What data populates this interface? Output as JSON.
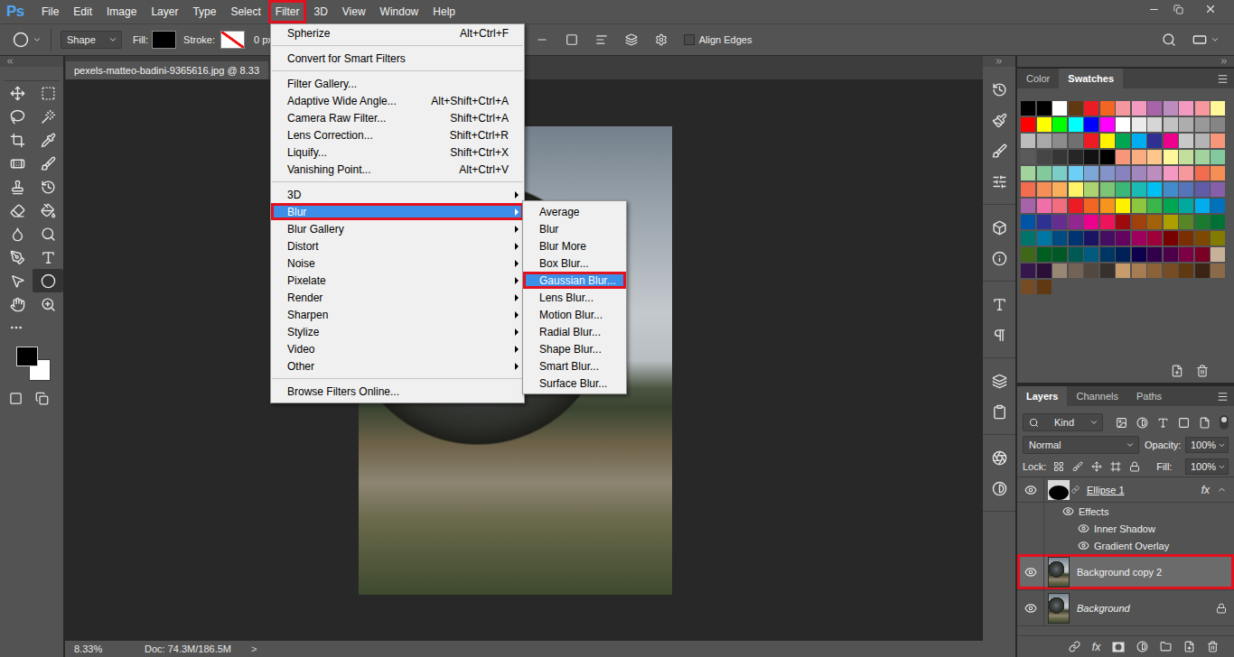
{
  "menu_bar": {
    "logo": "Ps",
    "items": [
      {
        "label": "File",
        "selected": false,
        "annotated": false
      },
      {
        "label": "Edit",
        "selected": false,
        "annotated": false
      },
      {
        "label": "Image",
        "selected": false,
        "annotated": false
      },
      {
        "label": "Layer",
        "selected": false,
        "annotated": false
      },
      {
        "label": "Type",
        "selected": false,
        "annotated": false
      },
      {
        "label": "Select",
        "selected": false,
        "annotated": false
      },
      {
        "label": "Filter",
        "selected": true,
        "annotated": true
      },
      {
        "label": "3D",
        "selected": false,
        "annotated": false
      },
      {
        "label": "View",
        "selected": false,
        "annotated": false
      },
      {
        "label": "Window",
        "selected": false,
        "annotated": false
      },
      {
        "label": "Help",
        "selected": false,
        "annotated": false
      }
    ]
  },
  "options_bar": {
    "mode": "Shape",
    "fill_label": "Fill:",
    "stroke_label": "Stroke:",
    "stroke_width": "0 px",
    "align_edges": {
      "label": "Align Edges",
      "checked": false
    }
  },
  "toolbar": {
    "tools": [
      {
        "selected": false
      },
      {
        "selected": false
      },
      {
        "selected": false
      },
      {
        "selected": false
      },
      {
        "selected": false
      },
      {
        "selected": false
      },
      {
        "selected": false
      },
      {
        "selected": false
      },
      {
        "selected": false
      },
      {
        "selected": false
      },
      {
        "selected": false
      },
      {
        "selected": false
      },
      {
        "selected": false
      },
      {
        "selected": false
      },
      {
        "selected": false
      },
      {
        "selected": false
      },
      {
        "selected": false
      },
      {
        "selected": true
      },
      {
        "selected": false
      },
      {
        "selected": false
      }
    ]
  },
  "document": {
    "tab": "pexels-matteo-badini-9365616.jpg @ 8.33"
  },
  "status_bar": {
    "zoom": "8.33%",
    "doc": "Doc: 74.3M/186.5M",
    "arrow": ">"
  },
  "filter_menu": {
    "items": [
      {
        "kind": "item",
        "label": "Spherize",
        "shortcut": "Alt+Ctrl+F",
        "submenu": false,
        "selected": false,
        "annotated": false
      },
      {
        "kind": "separator"
      },
      {
        "kind": "item",
        "label": "Convert for Smart Filters",
        "submenu": false,
        "selected": false,
        "annotated": false
      },
      {
        "kind": "separator"
      },
      {
        "kind": "item",
        "label": "Filter Gallery...",
        "submenu": false,
        "selected": false,
        "annotated": false
      },
      {
        "kind": "item",
        "label": "Adaptive Wide Angle...",
        "shortcut": "Alt+Shift+Ctrl+A",
        "submenu": false,
        "selected": false,
        "annotated": false
      },
      {
        "kind": "item",
        "label": "Camera Raw Filter...",
        "shortcut": "Shift+Ctrl+A",
        "submenu": false,
        "selected": false,
        "annotated": false
      },
      {
        "kind": "item",
        "label": "Lens Correction...",
        "shortcut": "Shift+Ctrl+R",
        "submenu": false,
        "selected": false,
        "annotated": false
      },
      {
        "kind": "item",
        "label": "Liquify...",
        "shortcut": "Shift+Ctrl+X",
        "submenu": false,
        "selected": false,
        "annotated": false
      },
      {
        "kind": "item",
        "label": "Vanishing Point...",
        "shortcut": "Alt+Ctrl+V",
        "submenu": false,
        "selected": false,
        "annotated": false
      },
      {
        "kind": "separator"
      },
      {
        "kind": "item",
        "label": "3D",
        "submenu": true,
        "selected": false,
        "annotated": false
      },
      {
        "kind": "item",
        "label": "Blur",
        "submenu": true,
        "selected": true,
        "annotated": true,
        "children": [
          {
            "kind": "item",
            "label": "Average",
            "selected": false,
            "annotated": false
          },
          {
            "kind": "item",
            "label": "Blur",
            "selected": false,
            "annotated": false
          },
          {
            "kind": "item",
            "label": "Blur More",
            "selected": false,
            "annotated": false
          },
          {
            "kind": "item",
            "label": "Box Blur...",
            "selected": false,
            "annotated": false
          },
          {
            "kind": "item",
            "label": "Gaussian Blur...",
            "selected": true,
            "annotated": true
          },
          {
            "kind": "item",
            "label": "Lens Blur...",
            "selected": false,
            "annotated": false
          },
          {
            "kind": "item",
            "label": "Motion Blur...",
            "selected": false,
            "annotated": false
          },
          {
            "kind": "item",
            "label": "Radial Blur...",
            "selected": false,
            "annotated": false
          },
          {
            "kind": "item",
            "label": "Shape Blur...",
            "selected": false,
            "annotated": false
          },
          {
            "kind": "item",
            "label": "Smart Blur...",
            "selected": false,
            "annotated": false
          },
          {
            "kind": "item",
            "label": "Surface Blur...",
            "selected": false,
            "annotated": false
          }
        ]
      },
      {
        "kind": "item",
        "label": "Blur Gallery",
        "submenu": true,
        "selected": false,
        "annotated": false
      },
      {
        "kind": "item",
        "label": "Distort",
        "submenu": true,
        "selected": false,
        "annotated": false
      },
      {
        "kind": "item",
        "label": "Noise",
        "submenu": true,
        "selected": false,
        "annotated": false
      },
      {
        "kind": "item",
        "label": "Pixelate",
        "submenu": true,
        "selected": false,
        "annotated": false
      },
      {
        "kind": "item",
        "label": "Render",
        "submenu": true,
        "selected": false,
        "annotated": false
      },
      {
        "kind": "item",
        "label": "Sharpen",
        "submenu": true,
        "selected": false,
        "annotated": false
      },
      {
        "kind": "item",
        "label": "Stylize",
        "submenu": true,
        "selected": false,
        "annotated": false
      },
      {
        "kind": "item",
        "label": "Video",
        "submenu": true,
        "selected": false,
        "annotated": false
      },
      {
        "kind": "item",
        "label": "Other",
        "submenu": true,
        "selected": false,
        "annotated": false
      },
      {
        "kind": "separator"
      },
      {
        "kind": "item",
        "label": "Browse Filters Online...",
        "submenu": false,
        "selected": false,
        "annotated": false
      }
    ]
  },
  "color_panel": {
    "tabs": [
      {
        "label": "Color",
        "selected": false
      },
      {
        "label": "Swatches",
        "selected": true
      }
    ],
    "swatches": [
      "#000000",
      "#000000",
      "#ffffff",
      "#603913",
      "#ed1c24",
      "#f26522",
      "#f5989d",
      "#f49ac1",
      "#a864a8",
      "#bd8cbf",
      "#f49ac2",
      "#f6989d",
      "#fff799",
      "#ff0000",
      "#ffff00",
      "#00ff00",
      "#00ffff",
      "#0000ff",
      "#ff00ff",
      "#ffffff",
      "#ebebeb",
      "#d6d6d6",
      "#c2c2c2",
      "#adadad",
      "#999999",
      "#858585",
      "#bcbcbc",
      "#a8a8a8",
      "#8c8c8c",
      "#707070",
      "#ed1c24",
      "#fff200",
      "#00a651",
      "#00aeef",
      "#2e3192",
      "#ec008c",
      "#c8c8c8",
      "#b4b4b4",
      "#f7977a",
      "#5a5a5a",
      "#464646",
      "#363636",
      "#262626",
      "#121212",
      "#000000",
      "#f7977a",
      "#f9ad81",
      "#fdc68a",
      "#fff79a",
      "#c4df9b",
      "#a3d39c",
      "#82ca9d",
      "#a2d39c",
      "#82ca9c",
      "#7bcdc8",
      "#6ecff6",
      "#7ea7d8",
      "#8493ca",
      "#8882be",
      "#a187be",
      "#bc8dbf",
      "#f49ac2",
      "#f6989d",
      "#f26c4f",
      "#f68e55",
      "#f26c4f",
      "#f68e55",
      "#fbaf5c",
      "#fff467",
      "#acd372",
      "#7cc576",
      "#3bb878",
      "#1abbb4",
      "#00bff3",
      "#438ccb",
      "#5574b9",
      "#605ca8",
      "#855fa8",
      "#a763a8",
      "#f06eaa",
      "#f26d7d",
      "#ed1c24",
      "#f26522",
      "#f7941d",
      "#fff200",
      "#8dc73f",
      "#39b54a",
      "#00a651",
      "#00a99d",
      "#00aeef",
      "#0072bc",
      "#0054a6",
      "#2e3192",
      "#662d91",
      "#92278f",
      "#ec008c",
      "#ed145b",
      "#9e0b0f",
      "#a0410d",
      "#a36209",
      "#aba000",
      "#598527",
      "#1a7b30",
      "#007236",
      "#00746b",
      "#0076a3",
      "#004b80",
      "#003471",
      "#1b1464",
      "#440e62",
      "#630460",
      "#9e005d",
      "#9e0039",
      "#790000",
      "#7b2e00",
      "#7d4900",
      "#827b00",
      "#406618",
      "#005e20",
      "#005826",
      "#005952",
      "#005b7f",
      "#003663",
      "#002157",
      "#0d004c",
      "#32004b",
      "#4b0049",
      "#7b0046",
      "#7a0026",
      "#c7b299",
      "#36174d",
      "#2b0f38",
      "#998675",
      "#736357",
      "#534741",
      "#37302d",
      "#c69c6d",
      "#a67c52",
      "#8c6239",
      "#754c24",
      "#603913",
      "#3c2415",
      "#8a6a48",
      "#754c24",
      "#603913"
    ]
  },
  "layers_panel": {
    "tabs": [
      {
        "label": "Layers",
        "selected": true
      },
      {
        "label": "Channels",
        "selected": false
      },
      {
        "label": "Paths",
        "selected": false
      }
    ],
    "filter": "Kind",
    "blend_mode": "Normal",
    "opacity_label": "Opacity:",
    "opacity": "100%",
    "lock_label": "Lock:",
    "fill_label": "Fill:",
    "fill": "100%",
    "layers": [
      {
        "kind": "shape",
        "name": "Ellipse 1",
        "visible": true,
        "selected": false,
        "annotated": false,
        "expanded": true,
        "fx": "fx",
        "locked": false
      },
      {
        "kind": "effects",
        "name": "Effects",
        "visible": true
      },
      {
        "kind": "effect",
        "name": "Inner Shadow",
        "visible": true
      },
      {
        "kind": "effect",
        "name": "Gradient Overlay",
        "visible": true
      },
      {
        "kind": "image",
        "name": "Background copy 2",
        "visible": true,
        "selected": true,
        "annotated": true,
        "locked": false
      },
      {
        "kind": "image",
        "name": "Background",
        "visible": true,
        "selected": false,
        "annotated": false,
        "locked": true
      }
    ],
    "footer_fx": "fx"
  }
}
